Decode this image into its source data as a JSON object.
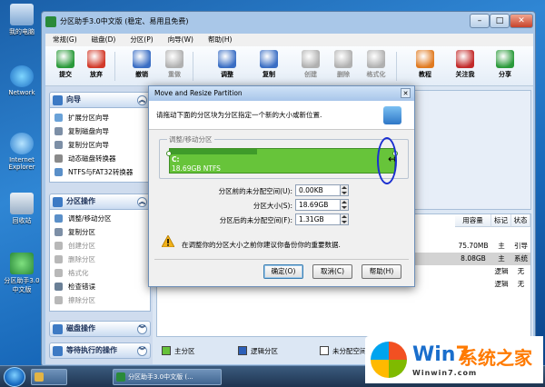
{
  "desktop": {
    "icons": [
      {
        "label": "我的电脑"
      },
      {
        "label": "Network"
      },
      {
        "label": "Internet Explorer"
      },
      {
        "label": "回收站"
      },
      {
        "label": "分区助手3.0中文版"
      }
    ]
  },
  "window": {
    "title": "分区助手3.0中文版 (稳定、易用且免费)",
    "menu": [
      "常规(G)",
      "磁盘(D)",
      "分区(P)",
      "向导(W)",
      "帮助(H)"
    ],
    "toolbar": [
      {
        "label": "提交",
        "icon": "checkmark-icon",
        "color": "#2a9a3a"
      },
      {
        "label": "放弃",
        "icon": "cross-icon",
        "color": "#d23a2a"
      },
      {
        "label": "撤销",
        "icon": "undo-icon",
        "color": "#3a6ec4"
      },
      {
        "label": "重做",
        "icon": "redo-icon",
        "color": "#b0b0b0"
      },
      {
        "label": "调整",
        "icon": "resize-disk-icon",
        "color": "#3a6ec4"
      },
      {
        "label": "复制",
        "icon": "copy-disk-icon",
        "color": "#3a6ec4"
      },
      {
        "label": "创建",
        "icon": "create-disk-icon",
        "color": "#b0b0b0"
      },
      {
        "label": "删除",
        "icon": "delete-disk-icon",
        "color": "#b0b0b0"
      },
      {
        "label": "格式化",
        "icon": "format-disk-icon",
        "color": "#b0b0b0"
      },
      {
        "label": "教程",
        "icon": "tutorial-icon",
        "color": "#e07a20"
      },
      {
        "label": "关注我",
        "icon": "follow-icon",
        "color": "#c22a2a"
      },
      {
        "label": "分享",
        "icon": "share-icon",
        "color": "#2a9a3a"
      }
    ]
  },
  "sidebar": {
    "wizard": {
      "title": "向导",
      "items": [
        "扩展分区向导",
        "复制磁盘向导",
        "复制分区向导",
        "动态磁盘转换器",
        "NTFS与FAT32转换器"
      ]
    },
    "partition_ops": {
      "title": "分区操作",
      "items": [
        {
          "label": "调整/移动分区",
          "enabled": true
        },
        {
          "label": "复制分区",
          "enabled": true
        },
        {
          "label": "创建分区",
          "enabled": false
        },
        {
          "label": "删除分区",
          "enabled": false
        },
        {
          "label": "格式化",
          "enabled": false
        },
        {
          "label": "检查错误",
          "enabled": true
        },
        {
          "label": "擦除分区",
          "enabled": false
        }
      ]
    },
    "disk_ops": {
      "title": "磁盘操作"
    },
    "pending": {
      "title": "等待执行的操作"
    }
  },
  "partitions": {
    "headers": [
      "用容量",
      "标记",
      "状态"
    ],
    "rows": [
      {
        "used": "75.70MB",
        "flag": "主",
        "status": "引导"
      },
      {
        "used": "8.08GB",
        "flag": "主",
        "status": "系统"
      },
      {
        "used": "",
        "flag": "逻辑",
        "status": "无"
      },
      {
        "used": "",
        "flag": "逻辑",
        "status": "无"
      }
    ]
  },
  "legend": [
    "主分区",
    "逻辑分区",
    "未分配空间"
  ],
  "legend_colors": [
    "#66c23a",
    "#2c5fb8",
    "#ffffff"
  ],
  "dialog": {
    "title": "Move and Resize Partition",
    "close": "✕",
    "header": "请拖动下面的分区块为分区指定一个新的大小或新位置.",
    "group_label": "调整/移动分区",
    "partition_name": "C:",
    "partition_size": "18.69GB NTFS",
    "used_fraction": 0.39,
    "resize_glyph": "↔",
    "fields": [
      {
        "label": "分区前的未分配空间(U):",
        "value": "0.00KB"
      },
      {
        "label": "分区大小(S):",
        "value": "18.69GB"
      },
      {
        "label": "分区后的未分配空间(F):",
        "value": "1.31GB"
      }
    ],
    "warning": "在调整你的分区大小之前你建议你备份你的重要数据.",
    "buttons": {
      "ok": "确定(O)",
      "cancel": "取消(C)",
      "help": "帮助(H)"
    }
  },
  "taskbar": {
    "task": "分区助手3.0中文版 (..."
  },
  "watermark": {
    "brand_a": "Win",
    "brand_b": "7",
    "brand_c": "系统之家",
    "url": "Winwin7.com"
  }
}
